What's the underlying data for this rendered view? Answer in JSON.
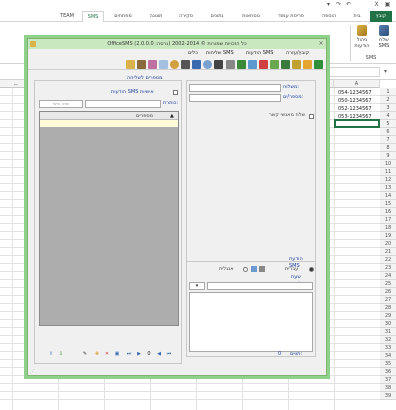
{
  "excel": {
    "tabs": [
      "קובץ",
      "בית",
      "הוספה",
      "פריסת עמוד",
      "נוסחאות",
      "נתונים",
      "סקירה",
      "תצוגה",
      "מפתחים",
      "SMS",
      "TEAM"
    ],
    "ribbon_buttons": [
      {
        "label": "שלח\nSMS",
        "icon": "send-sms-icon"
      },
      {
        "label": "ניהול\nהודעות",
        "icon": "manage-messages-icon"
      }
    ],
    "ribbon_group": "SMS",
    "column_header": "A",
    "rows": [
      "1",
      "2",
      "3",
      "4",
      "5",
      "6",
      "7",
      "8",
      "9",
      "10",
      "11",
      "12",
      "13",
      "14",
      "15",
      "16",
      "17",
      "18",
      "19",
      "20",
      "21",
      "22",
      "23",
      "24",
      "25",
      "26",
      "27",
      "28",
      "29",
      "30",
      "31",
      "32",
      "33",
      "34",
      "35",
      "36",
      "37",
      "38",
      "39"
    ],
    "cells": [
      "054-1234567",
      "050-1234567",
      "052-1234567",
      "053-1234567"
    ]
  },
  "dialog": {
    "title": "OfficeSMS כל הזכויות שמורות © 2002-2014 (גרסה: 2.0.0.0)",
    "menu": [
      "קובץ/עזרה",
      "הודעות SMS",
      "שליחות SMS",
      "כלים",
      "יציאה"
    ],
    "recipients": {
      "sender_label": "משלוח:",
      "destination_label": "מספר/ים:",
      "send_to_contacts_label": "שלח מאנשי קשר"
    },
    "right_panel": {
      "title": "מספרים לשליחה",
      "personal_sms_label": "הודעות SMS אישיות",
      "title_label": "כותרת:",
      "personal_field_label": "שדה אישי",
      "list_header": "מספרים"
    },
    "message": {
      "title": "הודעת SMS",
      "hebrew_label": "עברית",
      "english_label": "אנגלית",
      "schedule_label": "שעת שליחה",
      "chars_label": "תווים:",
      "chars_value": "0"
    },
    "nav": {
      "record_value": "0"
    },
    "accent": "#1a3c9e",
    "frame": "#8fd18a"
  }
}
